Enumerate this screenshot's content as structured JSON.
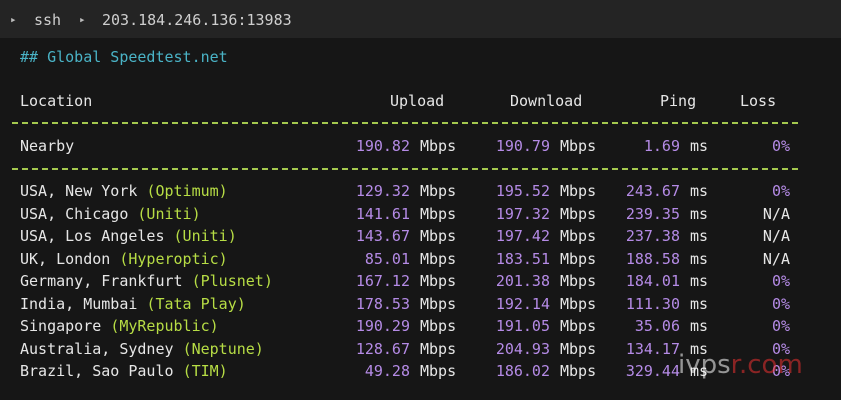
{
  "titlebar": {
    "arrow1": "▸",
    "label": "ssh",
    "arrow2": "▸",
    "host": "203.184.246.136:13983"
  },
  "heading": "## Global Speedtest.net",
  "columns": {
    "location": "Location",
    "upload": "Upload",
    "download": "Download",
    "ping": "Ping",
    "loss": "Loss"
  },
  "nearby": {
    "location": "Nearby",
    "upload": "190.82",
    "upload_unit": "Mbps",
    "download": "190.79",
    "download_unit": "Mbps",
    "ping": "1.69",
    "ping_unit": "ms",
    "loss": "0%"
  },
  "rows": [
    {
      "loc": "USA, New York ",
      "isp": "(Optimum)",
      "upload": "129.32",
      "upload_unit": "Mbps",
      "download": "195.52",
      "download_unit": "Mbps",
      "ping": "243.67",
      "ping_unit": "ms",
      "loss": "0%"
    },
    {
      "loc": "USA, Chicago ",
      "isp": "(Uniti)",
      "upload": "141.61",
      "upload_unit": "Mbps",
      "download": "197.32",
      "download_unit": "Mbps",
      "ping": "239.35",
      "ping_unit": "ms",
      "loss": "N/A"
    },
    {
      "loc": "USA, Los Angeles ",
      "isp": "(Uniti)",
      "upload": "143.67",
      "upload_unit": "Mbps",
      "download": "197.42",
      "download_unit": "Mbps",
      "ping": "237.38",
      "ping_unit": "ms",
      "loss": "N/A"
    },
    {
      "loc": "UK, London ",
      "isp": "(Hyperoptic)",
      "upload": "85.01",
      "upload_unit": "Mbps",
      "download": "183.51",
      "download_unit": "Mbps",
      "ping": "188.58",
      "ping_unit": "ms",
      "loss": "N/A"
    },
    {
      "loc": "Germany, Frankfurt ",
      "isp": "(Plusnet)",
      "upload": "167.12",
      "upload_unit": "Mbps",
      "download": "201.38",
      "download_unit": "Mbps",
      "ping": "184.01",
      "ping_unit": "ms",
      "loss": "0%"
    },
    {
      "loc": "India, Mumbai ",
      "isp": "(Tata Play)",
      "upload": "178.53",
      "upload_unit": "Mbps",
      "download": "192.14",
      "download_unit": "Mbps",
      "ping": "111.30",
      "ping_unit": "ms",
      "loss": "0%"
    },
    {
      "loc": "Singapore ",
      "isp": "(MyRepublic)",
      "upload": "190.29",
      "upload_unit": "Mbps",
      "download": "191.05",
      "download_unit": "Mbps",
      "ping": "35.06",
      "ping_unit": "ms",
      "loss": "0%"
    },
    {
      "loc": "Australia, Sydney ",
      "isp": "(Neptune)",
      "upload": "128.67",
      "upload_unit": "Mbps",
      "download": "204.93",
      "download_unit": "Mbps",
      "ping": "134.17",
      "ping_unit": "ms",
      "loss": "0%"
    },
    {
      "loc": "Brazil, Sao Paulo ",
      "isp": "(TIM)",
      "upload": "49.28",
      "upload_unit": "Mbps",
      "download": "186.02",
      "download_unit": "Mbps",
      "ping": "329.44",
      "ping_unit": "ms",
      "loss": "0%"
    }
  ],
  "watermark": {
    "part1": "ivps",
    "part2": "r.com"
  },
  "colors": {
    "background": "#161616",
    "heading": "#4ab3c6",
    "numbers": "#b58be6",
    "isp": "#b7dd45",
    "separator": "#a4c84e"
  }
}
